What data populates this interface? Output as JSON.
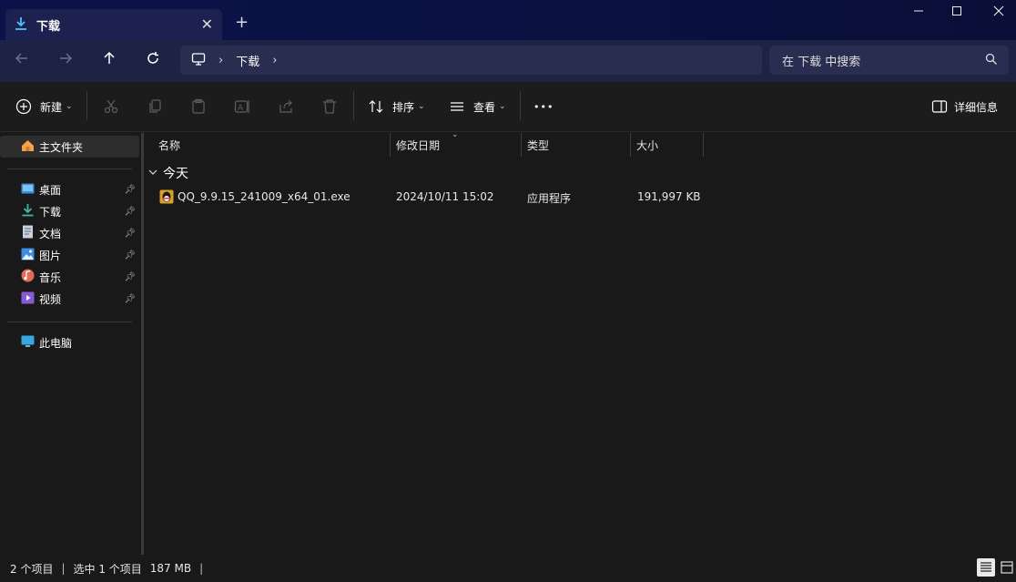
{
  "window": {
    "tab_title": "下载",
    "new_tab": "+",
    "minimize": "—",
    "maximize": "☐",
    "close": "✕"
  },
  "nav": {
    "breadcrumb": [
      "下载"
    ],
    "search_placeholder": "在 下载 中搜索"
  },
  "toolbar": {
    "new_label": "新建",
    "sort_label": "排序",
    "view_label": "查看",
    "more_label": "•••",
    "details_label": "详细信息"
  },
  "sidebar": {
    "home": "主文件夹",
    "pinned": [
      {
        "label": "桌面",
        "icon": "desktop-icon"
      },
      {
        "label": "下载",
        "icon": "download-icon"
      },
      {
        "label": "文档",
        "icon": "document-icon"
      },
      {
        "label": "图片",
        "icon": "pictures-icon"
      },
      {
        "label": "音乐",
        "icon": "music-icon"
      },
      {
        "label": "视频",
        "icon": "video-icon"
      }
    ],
    "this_pc": "此电脑"
  },
  "columns": [
    "名称",
    "修改日期",
    "类型",
    "大小"
  ],
  "groups": [
    {
      "label": "今天",
      "files": [
        {
          "name": "QQ_9.9.15_241009_x64_01.exe",
          "modified": "2024/10/11 15:02",
          "type": "应用程序",
          "size": "191,997 KB"
        }
      ]
    }
  ],
  "status": {
    "count": "2 个项目",
    "selected": "选中 1 个项目",
    "size": "187 MB",
    "separator": "|"
  },
  "colors": {
    "accent": "#4cc2ff",
    "titlebar": "#0b1249",
    "navbar": "#1e2245",
    "background": "#191919"
  }
}
